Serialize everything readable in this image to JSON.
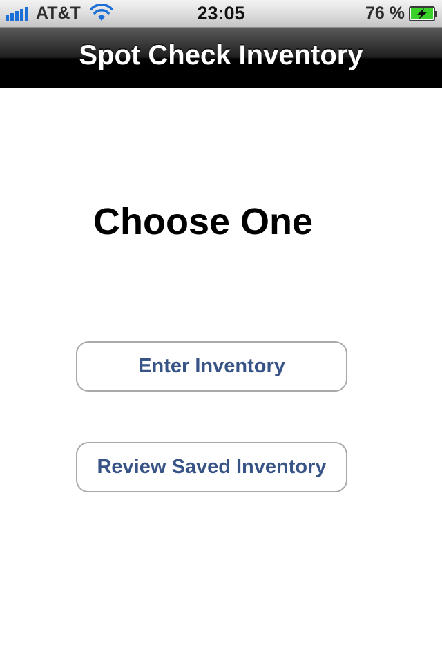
{
  "status_bar": {
    "carrier": "AT&T",
    "time": "23:05",
    "battery_percent": "76 %",
    "signal_icon": "signal-bars-icon",
    "wifi_icon": "wifi-icon",
    "battery_icon": "battery-charging-icon"
  },
  "nav_bar": {
    "title": "Spot Check Inventory"
  },
  "main": {
    "heading": "Choose One",
    "enter_button_label": "Enter Inventory",
    "review_button_label": "Review Saved Inventory"
  },
  "colors": {
    "button_text": "#385487",
    "nav_background": "#000000",
    "battery_fill": "#3ad12b"
  }
}
